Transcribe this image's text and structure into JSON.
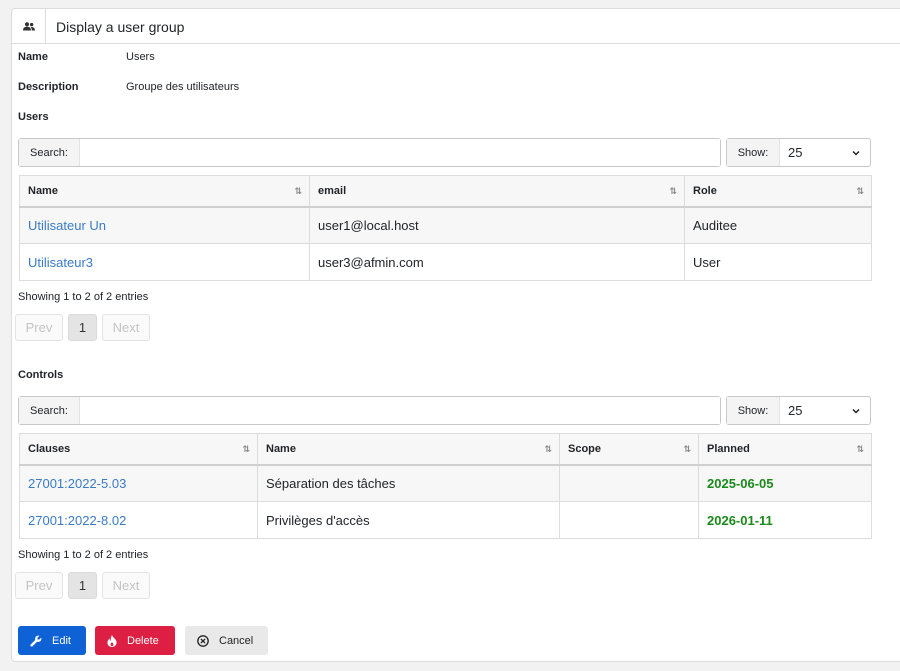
{
  "header": {
    "title": "Display a user group",
    "icon": "users-icon"
  },
  "fields": {
    "name_label": "Name",
    "name_value": "Users",
    "description_label": "Description",
    "description_value": "Groupe des utilisateurs"
  },
  "users_section": {
    "title": "Users",
    "search_label": "Search:",
    "search_value": "",
    "show_label": "Show:",
    "show_value": "25",
    "columns": [
      "Name",
      "email",
      "Role"
    ],
    "rows": [
      {
        "name": "Utilisateur Un",
        "email": "user1@local.host",
        "role": "Auditee"
      },
      {
        "name": "Utilisateur3",
        "email": "user3@afmin.com",
        "role": "User"
      }
    ],
    "info": "Showing 1 to 2 of 2 entries",
    "pager": {
      "prev": "Prev",
      "page": "1",
      "next": "Next"
    }
  },
  "controls_section": {
    "title": "Controls",
    "search_label": "Search:",
    "search_value": "",
    "show_label": "Show:",
    "show_value": "25",
    "columns": [
      "Clauses",
      "Name",
      "Scope",
      "Planned"
    ],
    "rows": [
      {
        "clause": "27001:2022-5.03",
        "name": "Séparation des tâches",
        "scope": "",
        "planned": "2025-06-05"
      },
      {
        "clause": "27001:2022-8.02",
        "name": "Privilèges d'accès",
        "scope": "",
        "planned": "2026-01-11"
      }
    ],
    "info": "Showing 1 to 2 of 2 entries",
    "pager": {
      "prev": "Prev",
      "page": "1",
      "next": "Next"
    }
  },
  "actions": {
    "edit": "Edit",
    "delete": "Delete",
    "cancel": "Cancel"
  },
  "colors": {
    "primary": "#0e62d6",
    "danger": "#dc1f43",
    "link": "#3a7bc8",
    "planned_date": "#1b8a1b"
  }
}
